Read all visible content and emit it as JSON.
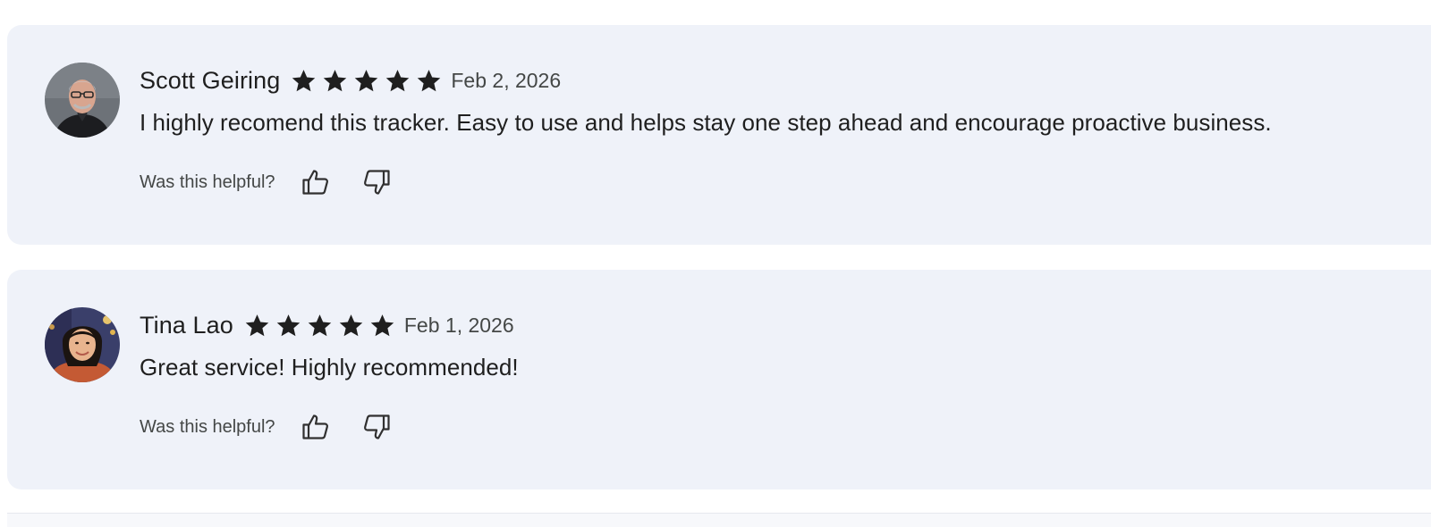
{
  "reviews": [
    {
      "name": "Scott Geiring",
      "rating": 5,
      "date": "Feb 2, 2026",
      "text": "I highly recomend this tracker. Easy to use and helps stay one step ahead and encourage proactive business.",
      "helpful_label": "Was this helpful?"
    },
    {
      "name": "Tina Lao",
      "rating": 5,
      "date": "Feb 1, 2026",
      "text": "Great service! Highly recommended!",
      "helpful_label": "Was this helpful?"
    }
  ],
  "icons": {
    "star": "star-icon",
    "thumbs_up": "thumbs-up-icon",
    "thumbs_down": "thumbs-down-icon"
  },
  "colors": {
    "card_background": "#eff2f9",
    "star": "#1f1f1f",
    "text": "#1f1f1f",
    "secondary_text": "#444746"
  }
}
